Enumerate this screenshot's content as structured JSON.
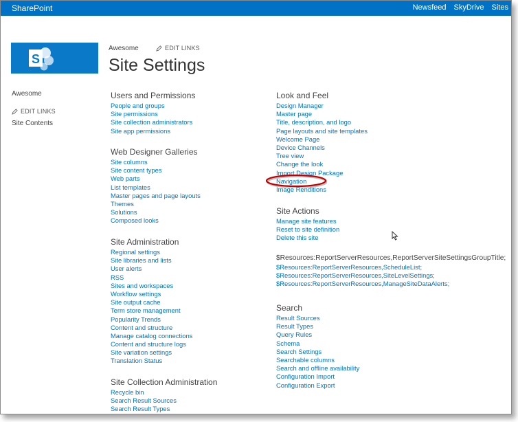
{
  "suitebar": {
    "brand": "SharePoint",
    "links": [
      "Newsfeed",
      "SkyDrive",
      "Sites"
    ]
  },
  "header": {
    "site_name": "Awesome",
    "edit_links": "EDIT LINKS",
    "title": "Site Settings"
  },
  "quicklaunch": {
    "site_name": "Awesome",
    "edit_links": "EDIT LINKS",
    "site_contents": "Site Contents"
  },
  "colors": {
    "suitebar": "#0072c6",
    "logo": "#0a79c8",
    "link": "#0072c6",
    "highlight": "#c00000"
  },
  "left_column": [
    {
      "title": "Users and Permissions",
      "links": [
        "People and groups",
        "Site permissions",
        "Site collection administrators",
        "Site app permissions"
      ]
    },
    {
      "title": "Web Designer Galleries",
      "links": [
        "Site columns",
        "Site content types",
        "Web parts",
        "List templates",
        "Master pages and page layouts",
        "Themes",
        "Solutions",
        "Composed looks"
      ]
    },
    {
      "title": "Site Administration",
      "links": [
        "Regional settings",
        "Site libraries and lists",
        "User alerts",
        "RSS",
        "Sites and workspaces",
        "Workflow settings",
        "Site output cache",
        "Term store management",
        "Popularity Trends",
        "Content and structure",
        "Manage catalog connections",
        "Content and structure logs",
        "Site variation settings",
        "Translation Status"
      ]
    },
    {
      "title": "Site Collection Administration",
      "links": [
        "Recycle bin",
        "Search Result Sources",
        "Search Result Types"
      ]
    }
  ],
  "right_column": [
    {
      "title": "Look and Feel",
      "links": [
        "Design Manager",
        "Master page",
        "Title, description, and logo",
        "Page layouts and site templates",
        "Welcome Page",
        "Device Channels",
        "Tree view",
        "Change the look",
        "Import Design Package",
        "Navigation",
        "Image Renditions"
      ]
    },
    {
      "title": "Site Actions",
      "links": [
        "Manage site features",
        "Reset to site definition",
        "Delete this site"
      ]
    },
    {
      "title": "$Resources:ReportServerResources,ReportServerSiteSettingsGroupTitle;",
      "links": [
        "$Resources:ReportServerResources,ScheduleList;",
        "$Resources:ReportServerResources,SiteLevelSettings;",
        "$Resources:ReportServerResources,ManageSiteDataAlerts;"
      ]
    },
    {
      "title": "Search",
      "links": [
        "Result Sources",
        "Result Types",
        "Query Rules",
        "Schema",
        "Search Settings",
        "Searchable columns",
        "Search and offline availability",
        "Configuration Import",
        "Configuration Export"
      ]
    }
  ]
}
